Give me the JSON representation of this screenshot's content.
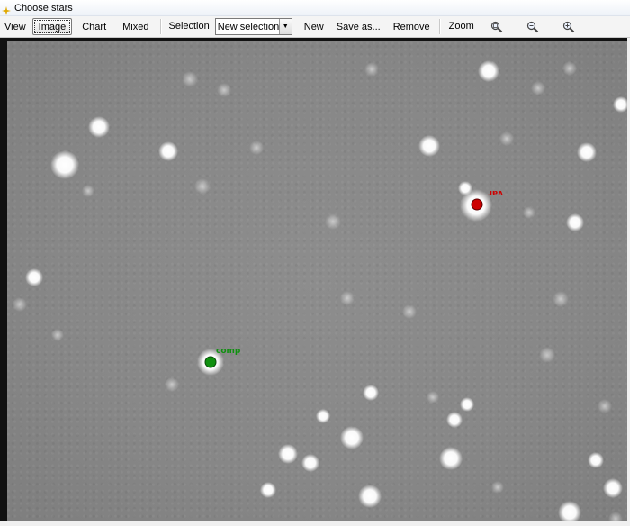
{
  "window": {
    "title": "Choose stars",
    "title_icon": "star-sparkle-icon"
  },
  "toolbar": {
    "view_label": "View",
    "image_label": "Image",
    "chart_label": "Chart",
    "mixed_label": "Mixed",
    "selection_label": "Selection",
    "selection_value": "New selection",
    "new_label": "New",
    "save_as_label": "Save as...",
    "remove_label": "Remove",
    "zoom_label": "Zoom",
    "zoom_icons": [
      "zoom-fit-icon",
      "zoom-out-icon",
      "zoom-in-icon"
    ]
  },
  "markers": [
    {
      "label": "var",
      "kind": "variable",
      "color": "#cc0000"
    },
    {
      "label": "comp",
      "kind": "comparison",
      "color": "#109010"
    }
  ],
  "colors": {
    "sky_gray": "#878787",
    "star_white": "#ffffff",
    "variable_red": "#cc0000",
    "comparison_green": "#109010"
  }
}
